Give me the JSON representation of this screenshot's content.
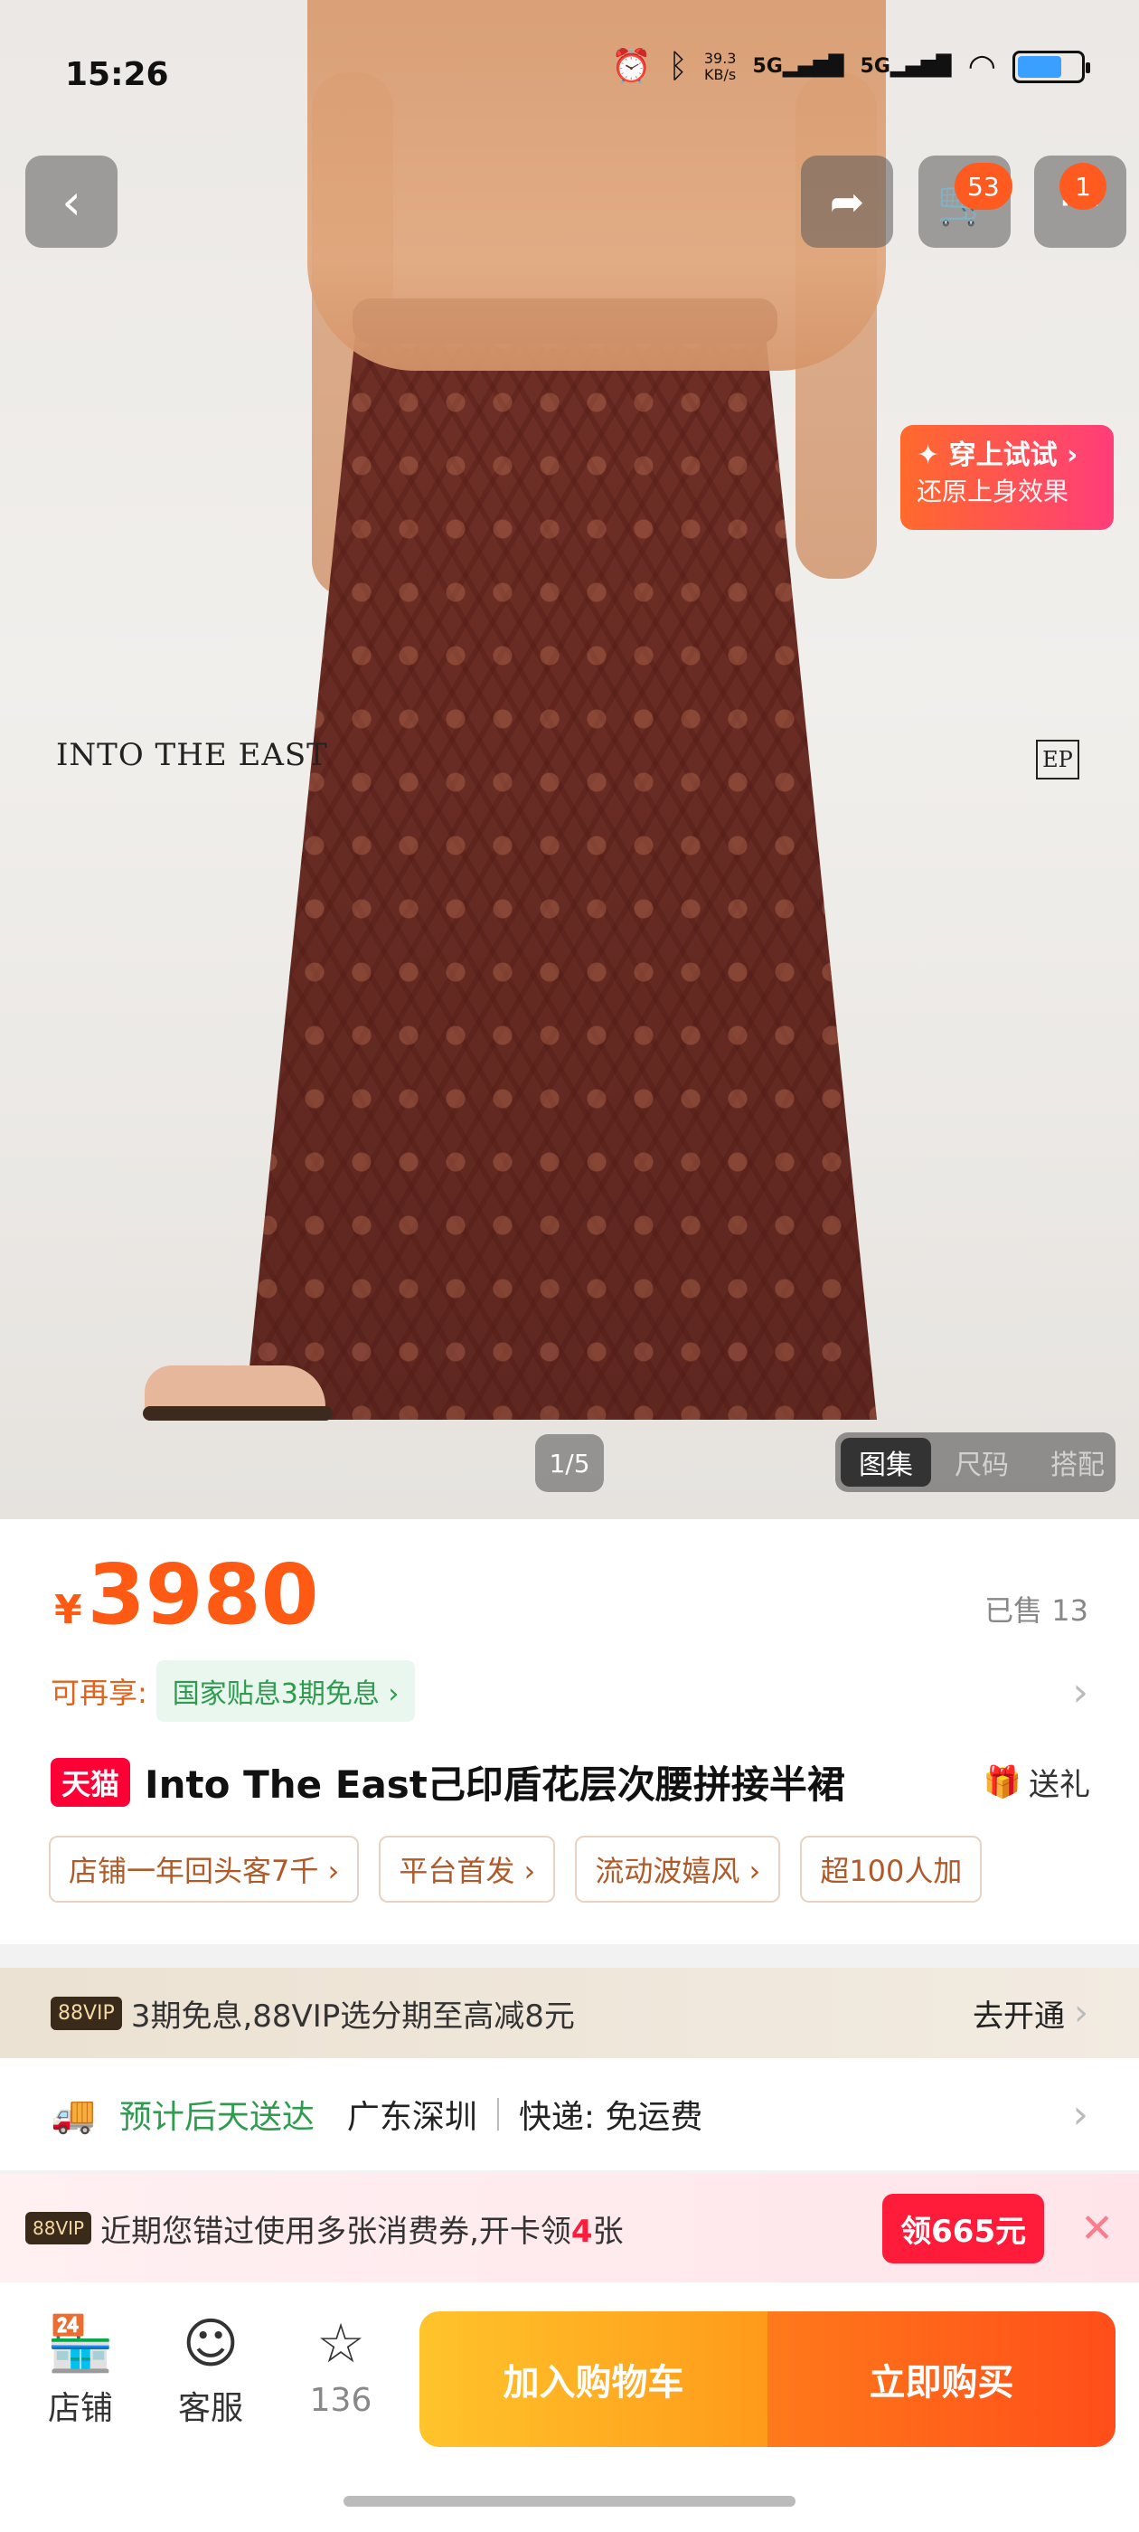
{
  "status_bar": {
    "time": "15:26",
    "net_speed": "39.3",
    "net_unit": "KB/s",
    "net1": "5G",
    "net2": "5G"
  },
  "nav": {
    "cart_count": "53",
    "more_count": "1"
  },
  "hero": {
    "brand_text": "INTO THE EAST",
    "brand_logo": "EP",
    "tryon_title": "✦ 穿上试试 ›",
    "tryon_sub": "还原上身效果",
    "counter": "1/5",
    "gallery_tabs": [
      "图集",
      "尺码",
      "搭配"
    ]
  },
  "product": {
    "currency": "¥",
    "price": "3980",
    "sold": "已售 13",
    "extra_label": "可再享:",
    "extra_chip": "国家贴息3期免息 ›",
    "mall_badge": "天猫",
    "title": "Into The East己印盾花层次腰拼接半裙",
    "gift": "送礼",
    "tags": [
      "店铺一年回头客7千 ›",
      "平台首发 ›",
      "流动波嬉风 ›",
      "超100人加"
    ]
  },
  "vip": {
    "badge": "88VIP",
    "text": "3期免息,88VIP选分期至高减8元",
    "action": "去开通"
  },
  "delivery": {
    "eta": "预计后天送达",
    "location": "广东深圳",
    "express": "快递: 免运费"
  },
  "coupon": {
    "badge": "88VIP",
    "text_prefix": "近期您错过使用多张消费券,开卡领",
    "highlight": "4",
    "text_suffix": "张",
    "button": "领665元"
  },
  "bottom_bar": {
    "shop": "店铺",
    "service": "客服",
    "favorites": "136",
    "add_to_cart": "加入购物车",
    "buy_now": "立即购买"
  },
  "colors": {
    "price": "#ff5a14",
    "tmall": "#ff0036",
    "green": "#2e9b4f",
    "cta_cart": "#ffb020",
    "cta_buy": "#ff5a1a"
  }
}
